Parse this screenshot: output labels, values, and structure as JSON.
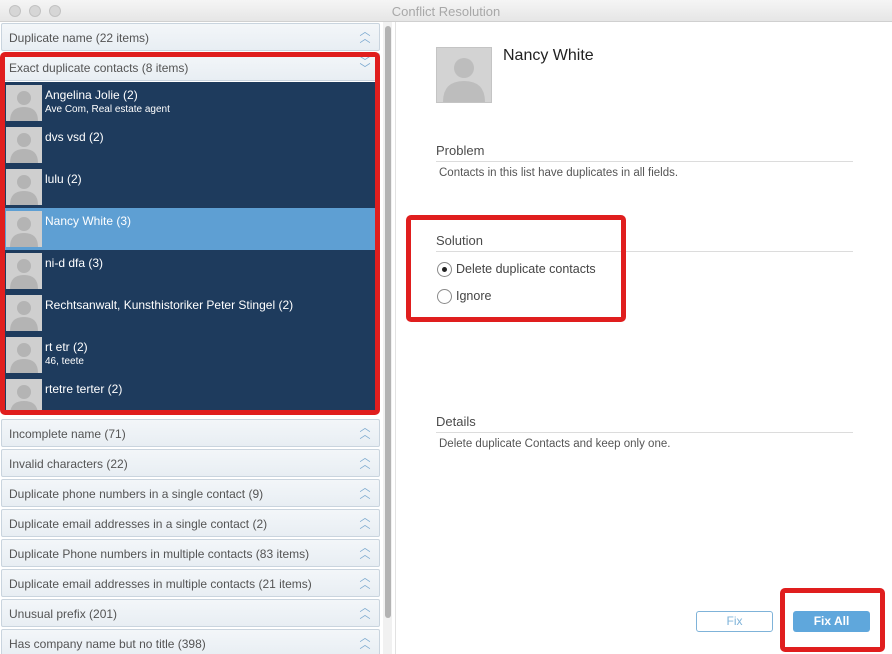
{
  "window": {
    "title": "Conflict Resolution"
  },
  "categories_top": [
    {
      "label": "Duplicate name (22 items)"
    },
    {
      "label": "Exact duplicate contacts (8 items)"
    }
  ],
  "contacts": [
    {
      "name": "Angelina Jolie (2)",
      "sub": "Ave Com, Real estate agent",
      "selected": false
    },
    {
      "name": "dvs vsd (2)",
      "sub": "",
      "selected": false
    },
    {
      "name": "lulu (2)",
      "sub": "",
      "selected": false
    },
    {
      "name": "Nancy White (3)",
      "sub": "",
      "selected": true
    },
    {
      "name": "ni-d dfa (3)",
      "sub": "",
      "selected": false
    },
    {
      "name": "Rechtsanwalt, Kunsthistoriker Peter Stingel (2)",
      "sub": "",
      "selected": false
    },
    {
      "name": "rt etr (2)",
      "sub": "46, teete",
      "selected": false
    },
    {
      "name": "rtetre terter (2)",
      "sub": "",
      "selected": false
    }
  ],
  "categories_bottom": [
    {
      "label": "Incomplete name (71)"
    },
    {
      "label": "Invalid characters (22)"
    },
    {
      "label": "Duplicate phone numbers in a single contact (9)"
    },
    {
      "label": "Duplicate email addresses in a single contact (2)"
    },
    {
      "label": "Duplicate Phone numbers in multiple contacts (83 items)"
    },
    {
      "label": "Duplicate email addresses in multiple contacts (21 items)"
    },
    {
      "label": "Unusual prefix (201)"
    },
    {
      "label": "Has company name but no title (398)"
    }
  ],
  "detail": {
    "name": "Nancy White",
    "problem_heading": "Problem",
    "problem_text": "Contacts in this list have duplicates in all fields.",
    "solution_heading": "Solution",
    "solution_options": [
      {
        "label": "Delete duplicate contacts",
        "checked": true
      },
      {
        "label": "Ignore",
        "checked": false
      }
    ],
    "details_heading": "Details",
    "details_text": "Delete duplicate Contacts and keep only one."
  },
  "buttons": {
    "fix": "Fix",
    "fix_all": "Fix All"
  },
  "colors": {
    "list_background": "#1e3b5d",
    "selected_row": "#5e9fd3",
    "highlight_box": "#e01e1e",
    "accent": "#5fa7dc"
  },
  "icons": {
    "collapse": "chevron-up-icon",
    "expand": "chevron-down-icon",
    "avatar": "person-silhouette-icon"
  }
}
